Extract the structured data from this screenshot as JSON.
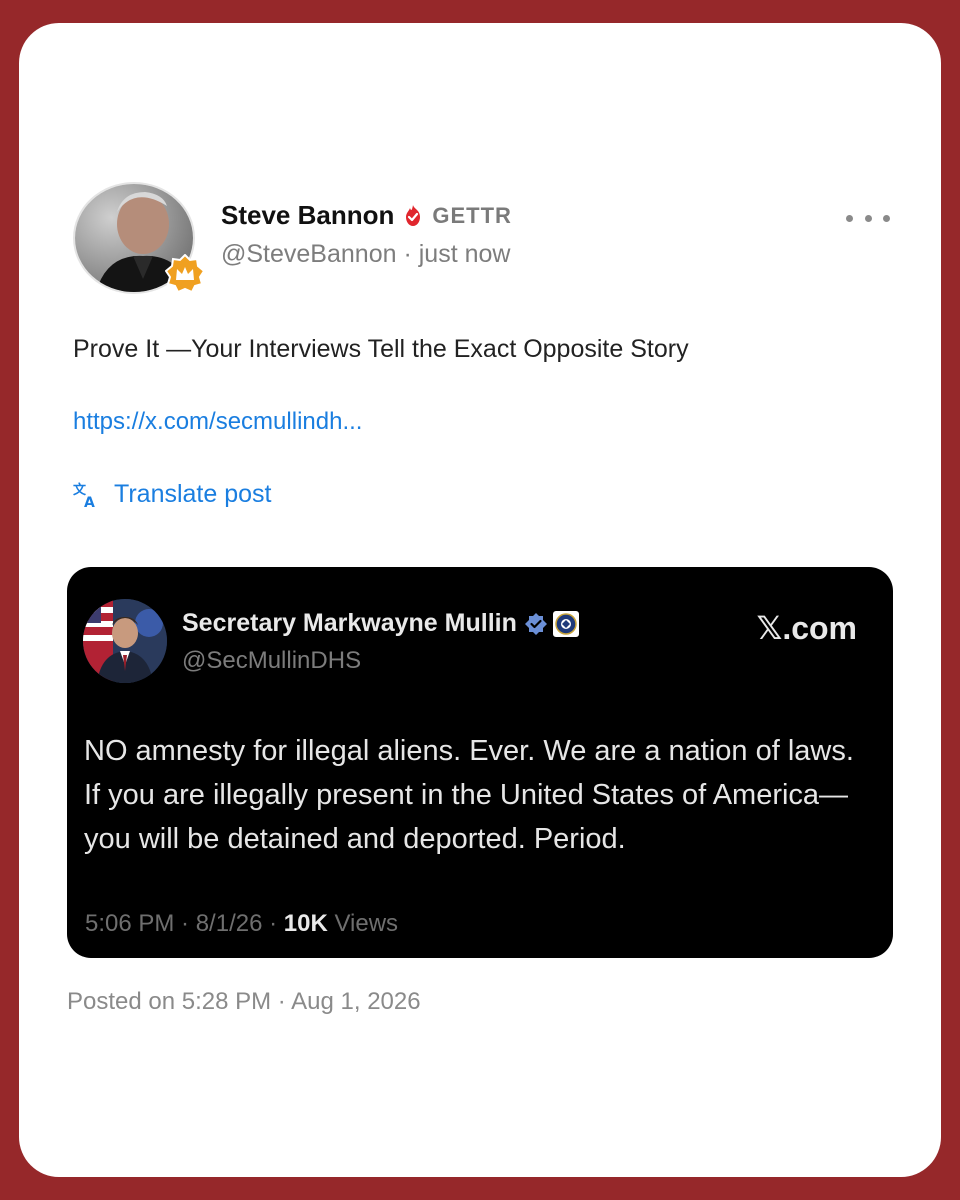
{
  "colors": {
    "background": "#96282a",
    "card": "#ffffff",
    "link": "#1a7ee0",
    "embed_background": "#000000",
    "verified_red": "#e0262d",
    "verified_blue": "#6b8fd6",
    "crown_badge": "#f0a020"
  },
  "post": {
    "author": {
      "name": "Steve Bannon",
      "verified_icon": "red-verified-flame-icon",
      "platform": "GETTR",
      "handle": "@SteveBannon",
      "separator": "·",
      "time": "just now",
      "avatar_badge_icon": "crown-badge-icon"
    },
    "more_icon": "ellipsis-icon",
    "text": "Prove It —Your Interviews Tell the Exact Opposite Story",
    "link": "https://x.com/secmullindh...",
    "translate": {
      "icon": "translate-icon",
      "label": "Translate post"
    },
    "embed": {
      "author_name": "Secretary Markwayne Mullin",
      "verified_icon": "blue-verified-icon",
      "seal_icon": "dhs-seal-icon",
      "handle": "@SecMullinDHS",
      "source": "𝕏.com",
      "body": "NO amnesty for illegal aliens. Ever. We are a nation of laws. If you are illegally present in the United States of America— you will be detained and deported. Period.",
      "meta_time": "5:06 PM · 8/1/26 · ",
      "meta_views_count": "10K",
      "meta_views_label": " Views"
    },
    "posted_on": "Posted on 5:28 PM · Aug 1, 2026"
  }
}
